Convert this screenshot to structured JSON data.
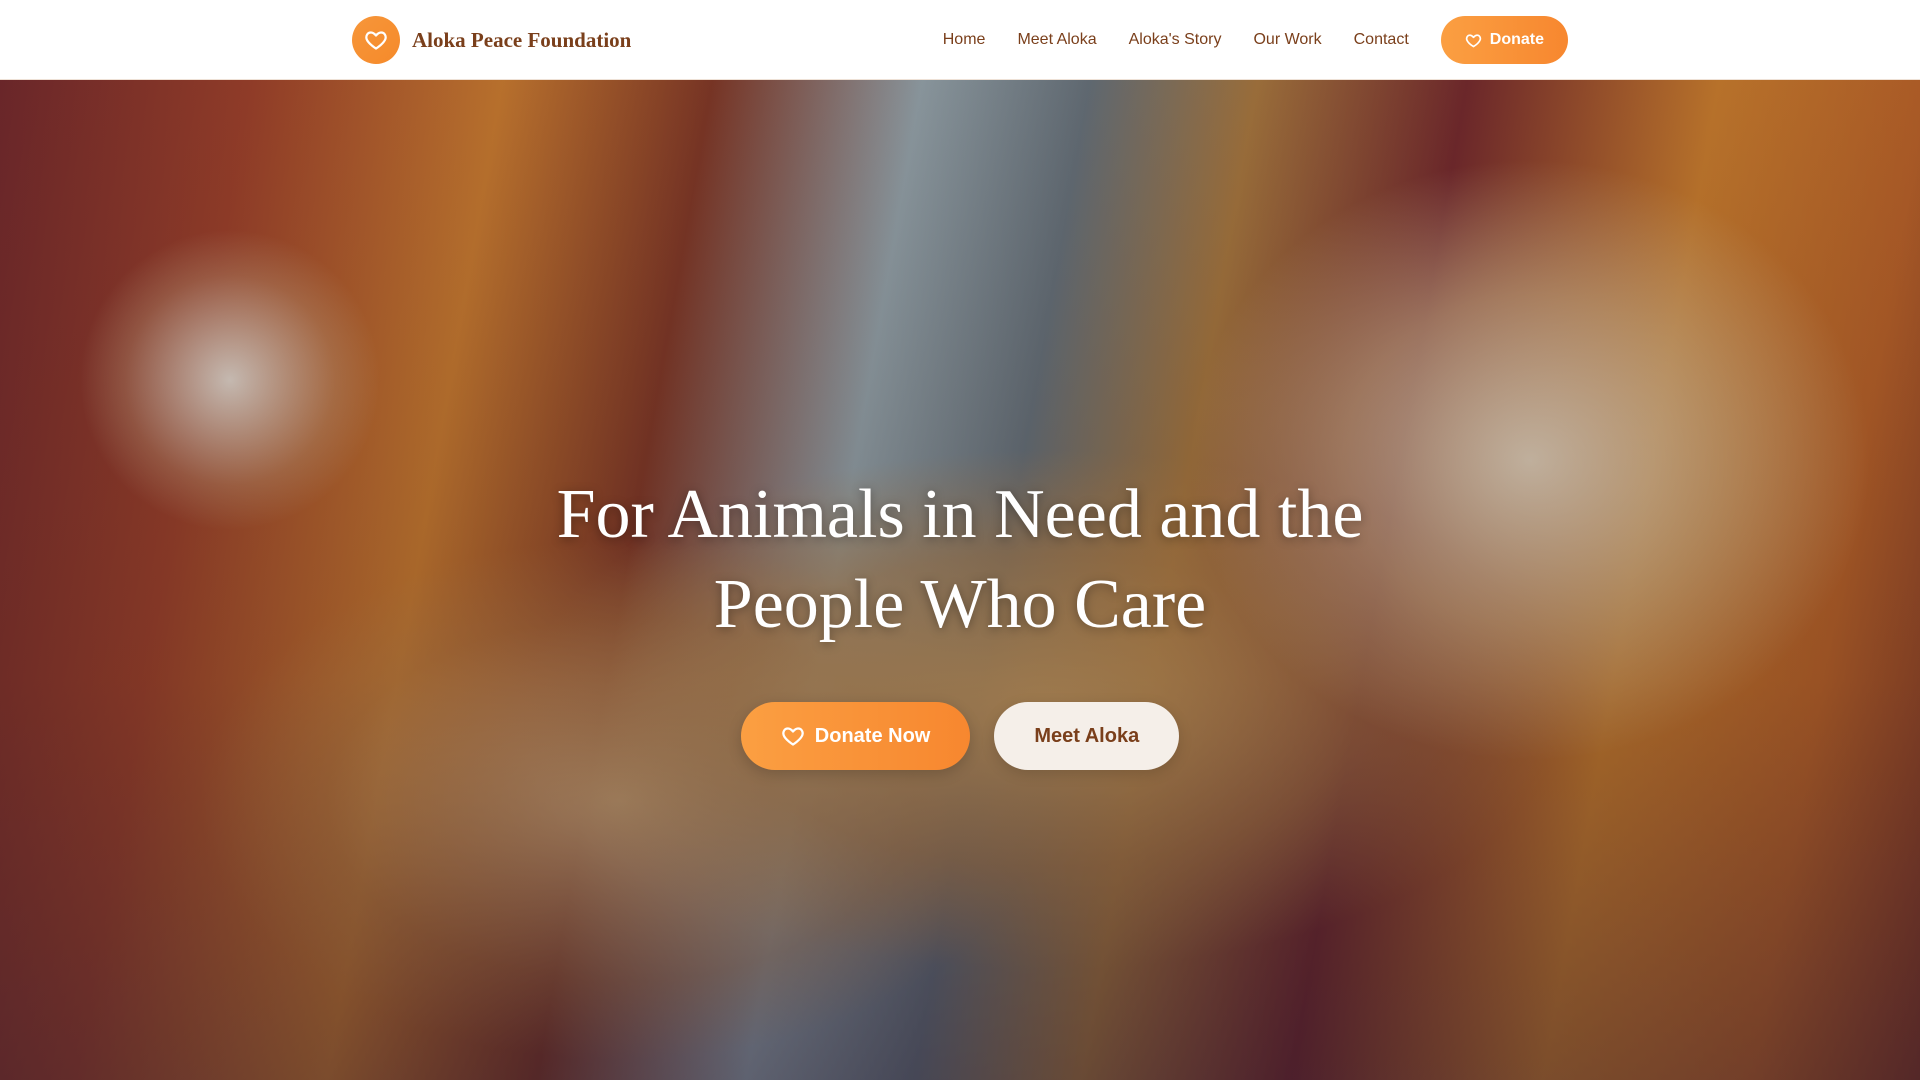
{
  "header": {
    "brand_name": "Aloka Peace Foundation",
    "brand_icon": "heart-icon",
    "nav": [
      {
        "label": "Home"
      },
      {
        "label": "Meet Aloka"
      },
      {
        "label": "Aloka's Story"
      },
      {
        "label": "Our Work"
      },
      {
        "label": "Contact"
      }
    ],
    "donate_label": "Donate"
  },
  "hero": {
    "title": "For Animals in Need and the People Who Care",
    "primary_label": "Donate Now",
    "primary_icon": "heart-icon",
    "secondary_label": "Meet Aloka"
  },
  "colors": {
    "accent": "#f7872f",
    "brand_text": "#7a3f1b",
    "secondary_button_bg": "#f5efe9"
  }
}
